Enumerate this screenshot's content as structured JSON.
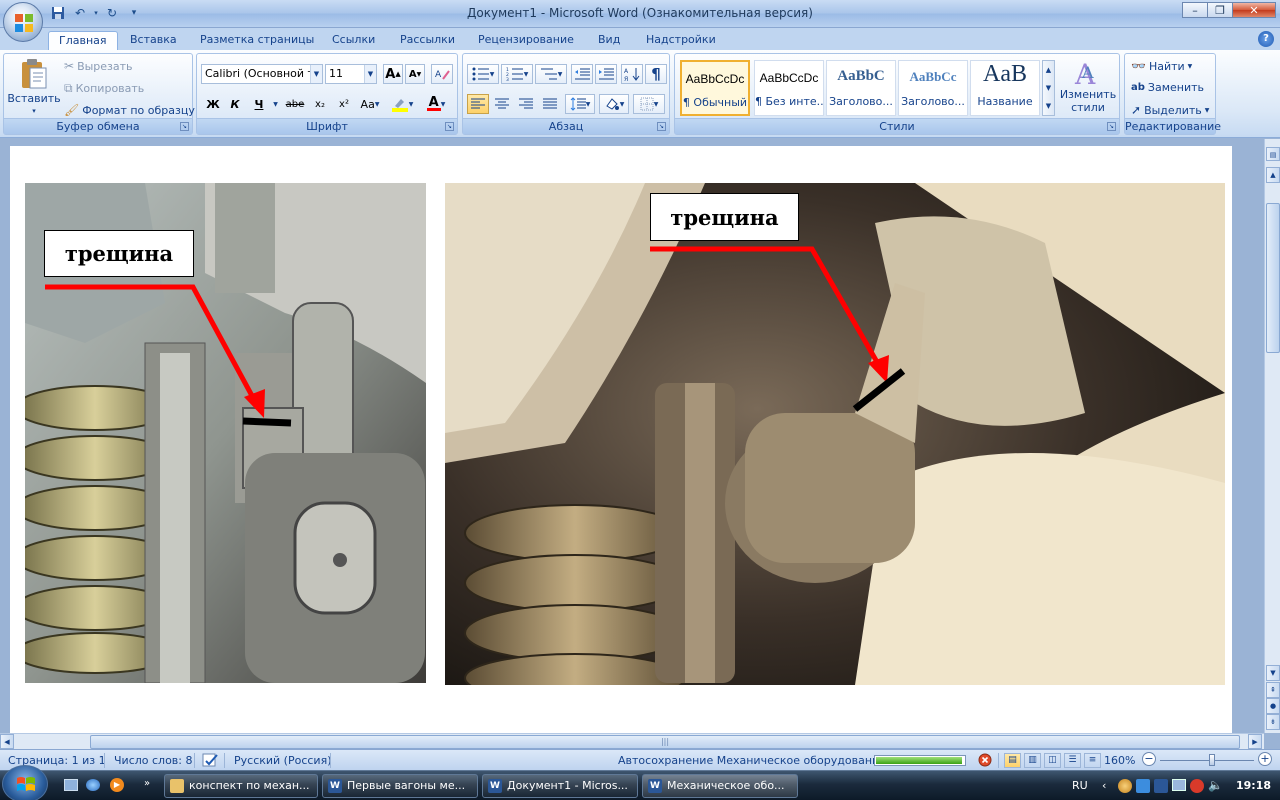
{
  "window": {
    "title": "Документ1 - Microsoft Word (Ознакомительная версия)",
    "qat_customize_glyph": "▾"
  },
  "tabs": [
    {
      "label": "Главная",
      "active": true
    },
    {
      "label": "Вставка"
    },
    {
      "label": "Разметка страницы"
    },
    {
      "label": "Ссылки"
    },
    {
      "label": "Рассылки"
    },
    {
      "label": "Рецензирование"
    },
    {
      "label": "Вид"
    },
    {
      "label": "Надстройки"
    }
  ],
  "ribbon": {
    "clipboard": {
      "group_label": "Буфер обмена",
      "paste": "Вставить",
      "cut": "Вырезать",
      "copy": "Копировать",
      "format_painter": "Формат по образцу"
    },
    "font": {
      "group_label": "Шрифт",
      "font_name": "Calibri (Основной те",
      "font_size": "11",
      "grow": "A",
      "shrink": "A",
      "bold": "Ж",
      "italic": "К",
      "underline": "Ч",
      "strike": "abe",
      "subscript": "x₂",
      "superscript": "x²",
      "change_case": "Aa",
      "font_color": "A",
      "highlight_color": "#ffff00",
      "font_color_value": "#ff0000"
    },
    "paragraph": {
      "group_label": "Абзац"
    },
    "styles": {
      "group_label": "Стили",
      "items": [
        {
          "sample": "AaBbCcDc",
          "name": "¶ Обычный",
          "selected": true
        },
        {
          "sample": "AaBbCcDc",
          "name": "¶ Без инте..."
        },
        {
          "sample": "AaBbC",
          "name": "Заголово..."
        },
        {
          "sample": "AaBbCc",
          "name": "Заголово..."
        },
        {
          "sample": "AaB",
          "name": "Название"
        }
      ],
      "change_styles": "Изменить стили"
    },
    "editing": {
      "group_label": "Редактирование",
      "find": "Найти",
      "replace": "Заменить",
      "select": "Выделить"
    }
  },
  "document": {
    "annotation_left": "трещина",
    "annotation_right": "трещина"
  },
  "statusbar": {
    "page": "Страница: 1 из 1",
    "words": "Число слов: 8",
    "language": "Русский (Россия)",
    "autosave": "Автосохранение Механическое оборудование:",
    "autosave_progress": 0.98,
    "zoom": "160%"
  },
  "taskbar": {
    "tasks": [
      {
        "label": "конспект по механ...",
        "active": false
      },
      {
        "label": "Первые вагоны ме...",
        "active": false
      },
      {
        "label": "Документ1 - Micros...",
        "active": false
      },
      {
        "label": "Механическое обо...",
        "active": true
      }
    ],
    "language": "RU",
    "clock": "19:18"
  }
}
